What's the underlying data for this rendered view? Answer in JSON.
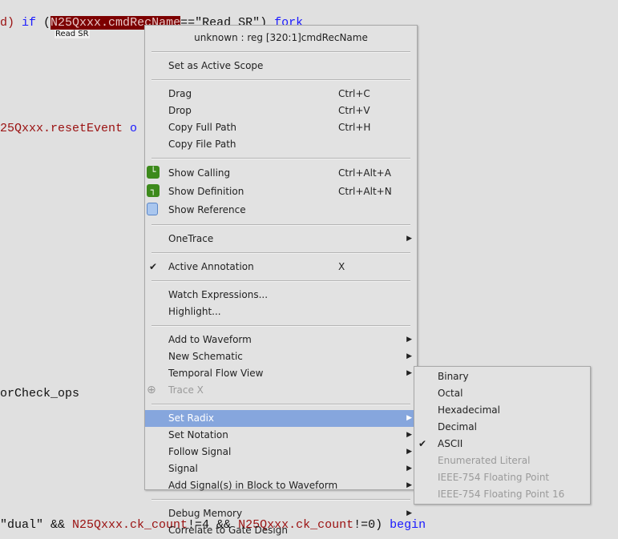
{
  "code": {
    "line1": {
      "pre": "d) ",
      "kw": "if",
      "open": " (",
      "selected": "N25Qxxx.cmdRecName",
      "rest": "==\"Read SR\") ",
      "kw2": "fork"
    },
    "tooltip": "Read SR",
    "line2": {
      "id": "25Qxxx.resetEvent",
      "kw": " o"
    },
    "line3": "orCheck_ops",
    "line4": {
      "a": "\"dual\" && ",
      "id1": "N25Qxxx.ck_count",
      "b": "!=4 && ",
      "id2": "N25Qxxx.ck_count",
      "c": "!=0) ",
      "kw": "begin"
    }
  },
  "context_menu": {
    "header": "unknown : reg [320:1]cmdRecName",
    "items": [
      {
        "type": "sep"
      },
      {
        "label": "Set as Active Scope",
        "mnemonic": "A"
      },
      {
        "type": "sep"
      },
      {
        "label": "Drag",
        "shortcut": "Ctrl+C"
      },
      {
        "label": "Drop",
        "shortcut": "Ctrl+V"
      },
      {
        "label": "Copy Full Path",
        "shortcut": "Ctrl+H",
        "mnemonic": "P"
      },
      {
        "label": "Copy File Path",
        "mnemonic": "F"
      },
      {
        "type": "sep"
      },
      {
        "label": "Show Calling",
        "shortcut": "Ctrl+Alt+A",
        "mnemonic": "n",
        "icon": "show-calling-icon",
        "tall": true
      },
      {
        "label": "Show Definition",
        "shortcut": "Ctrl+Alt+N",
        "mnemonic": "f",
        "icon": "show-definition-icon",
        "tall": true
      },
      {
        "label": "Show Reference",
        "mnemonic": "R",
        "icon": "show-reference-icon",
        "tall": true
      },
      {
        "type": "sep"
      },
      {
        "label": "OneTrace",
        "mnemonic": "T",
        "submenu": true
      },
      {
        "type": "sep"
      },
      {
        "label": "Active Annotation",
        "shortcut": "X",
        "mnemonic": "A",
        "checked": true
      },
      {
        "type": "sep"
      },
      {
        "label": "Watch Expressions...",
        "mnemonic": "W"
      },
      {
        "label": "Highlight...",
        "mnemonic": "H"
      },
      {
        "type": "sep"
      },
      {
        "label": "Add to Waveform",
        "mnemonic": "W",
        "submenu": true
      },
      {
        "label": "New Schematic",
        "mnemonic": "N",
        "submenu": true
      },
      {
        "label": "Temporal Flow View",
        "mnemonic": "m",
        "submenu": true
      },
      {
        "label": "Trace X",
        "mnemonic": "X",
        "disabled": true,
        "icon": "trace-x-icon"
      },
      {
        "type": "sep"
      },
      {
        "label": "Set Radix",
        "mnemonic": "R",
        "submenu": true,
        "highlighted": true
      },
      {
        "label": "Set Notation",
        "mnemonic": "N",
        "submenu": true
      },
      {
        "label": "Follow Signal",
        "mnemonic": "F",
        "submenu": true
      },
      {
        "label": "Signal",
        "mnemonic": "i",
        "submenu": true
      },
      {
        "label": "Add Signal(s) in Block to Waveform",
        "mnemonic": "B",
        "submenu": true
      },
      {
        "type": "sep"
      },
      {
        "label": "Debug Memory",
        "mnemonic": "D",
        "submenu": true
      },
      {
        "label": "Correlate to Gate Design",
        "mnemonic": "G"
      }
    ]
  },
  "radix_submenu": {
    "items": [
      {
        "label": "Binary",
        "mnemonic": "B"
      },
      {
        "label": "Octal",
        "mnemonic": "O"
      },
      {
        "label": "Hexadecimal",
        "mnemonic": "H"
      },
      {
        "label": "Decimal",
        "mnemonic": "D"
      },
      {
        "label": "ASCII",
        "mnemonic": "A",
        "checked": true
      },
      {
        "label": "Enumerated Literal",
        "mnemonic": "E",
        "disabled": true
      },
      {
        "label": "IEEE-754 Floating Point",
        "mnemonic": "I",
        "disabled": true
      },
      {
        "label": "IEEE-754 Floating Point 16",
        "mnemonic": "F",
        "disabled": true
      }
    ]
  },
  "colors": {
    "selection": "#7d0000",
    "highlight": "#86a6dd",
    "keyword": "#1a1aff",
    "identifier": "#9a1010"
  }
}
